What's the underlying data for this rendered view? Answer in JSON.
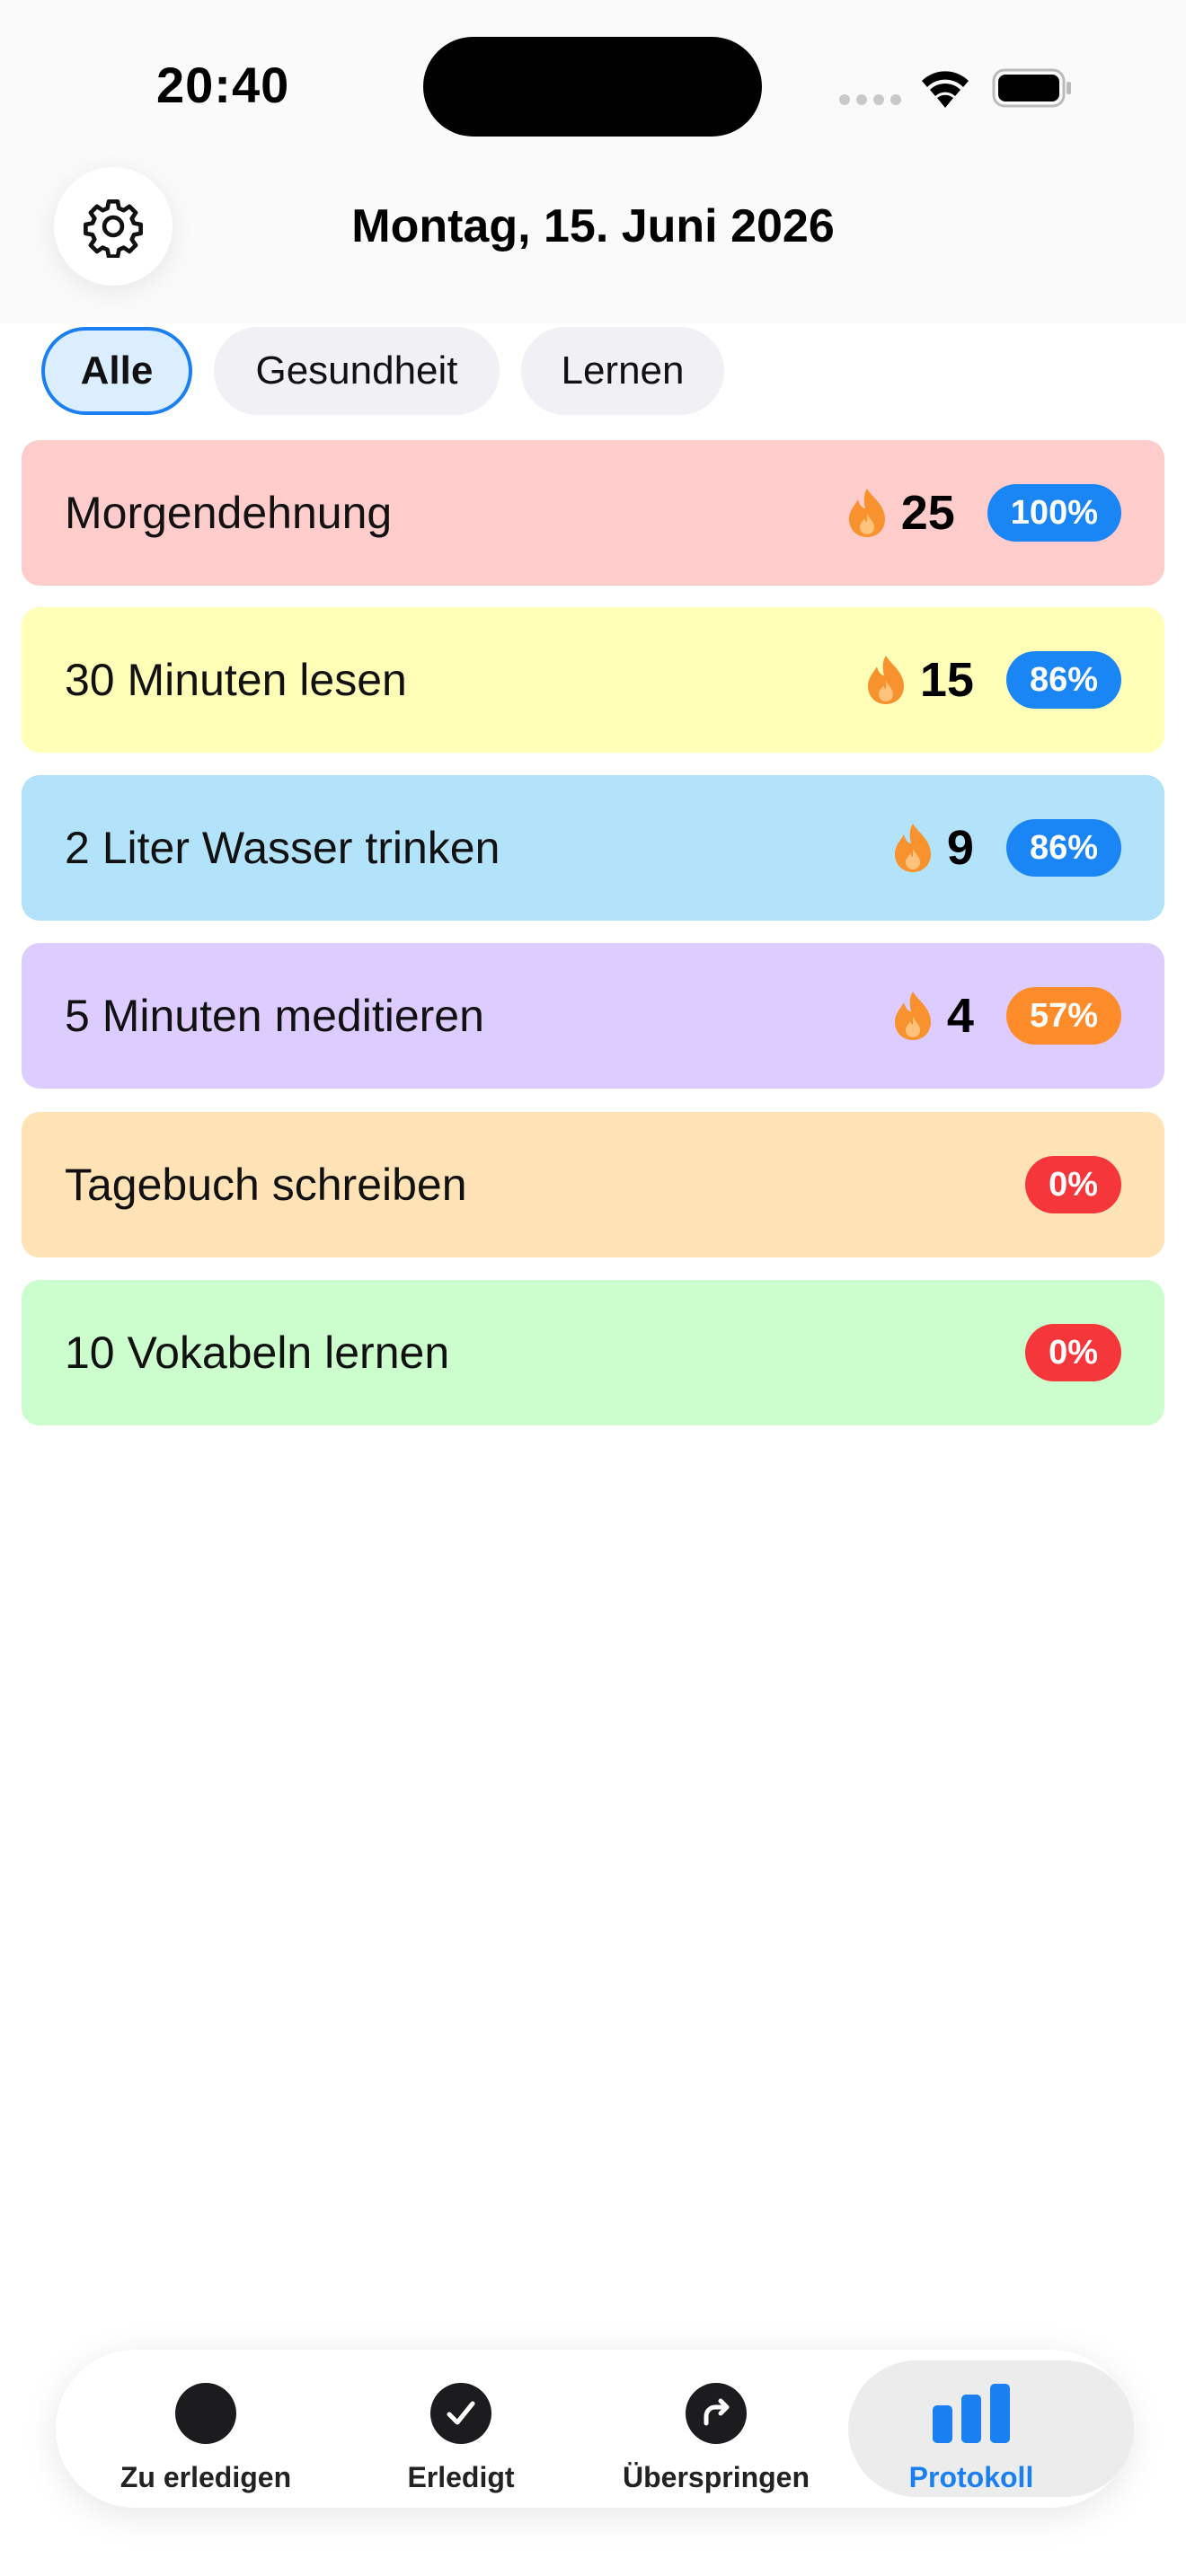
{
  "status": {
    "time": "20:40"
  },
  "header": {
    "title": "Montag, 15. Juni 2026",
    "settings_icon": "gear-icon"
  },
  "filters": [
    {
      "label": "Alle",
      "active": true
    },
    {
      "label": "Gesundheit",
      "active": false
    },
    {
      "label": "Lernen",
      "active": false
    }
  ],
  "habits": [
    {
      "name": "Morgendehnung",
      "streak": "25",
      "percent": "100%",
      "color": "#ffcccc",
      "badge_color": "#1a86f5"
    },
    {
      "name": "30 Minuten lesen",
      "streak": "15",
      "percent": "86%",
      "color": "#ffffb8",
      "badge_color": "#1a86f5"
    },
    {
      "name": "2 Liter Wasser trinken",
      "streak": "9",
      "percent": "86%",
      "color": "#b3e3fb",
      "badge_color": "#1a86f5"
    },
    {
      "name": "5 Minuten meditieren",
      "streak": "4",
      "percent": "57%",
      "color": "#dcccff",
      "badge_color": "#ff8c2a"
    },
    {
      "name": "Tagebuch schreiben",
      "streak": "",
      "percent": "0%",
      "color": "#ffe2b5",
      "badge_color": "#f5363b"
    },
    {
      "name": "10 Vokabeln lernen",
      "streak": "",
      "percent": "0%",
      "color": "#ccfdcc",
      "badge_color": "#f5363b"
    }
  ],
  "tabbar": {
    "tabs": [
      {
        "label": "Zu erledigen",
        "icon": "circle-icon",
        "active": false
      },
      {
        "label": "Erledigt",
        "icon": "checkmark-circle-icon",
        "active": false
      },
      {
        "label": "Überspringen",
        "icon": "skip-arrow-icon",
        "active": false
      },
      {
        "label": "Protokoll",
        "icon": "bar-chart-icon",
        "active": true
      }
    ]
  },
  "colors": {
    "accent": "#1a7ff0",
    "flame": "#f7922e"
  }
}
